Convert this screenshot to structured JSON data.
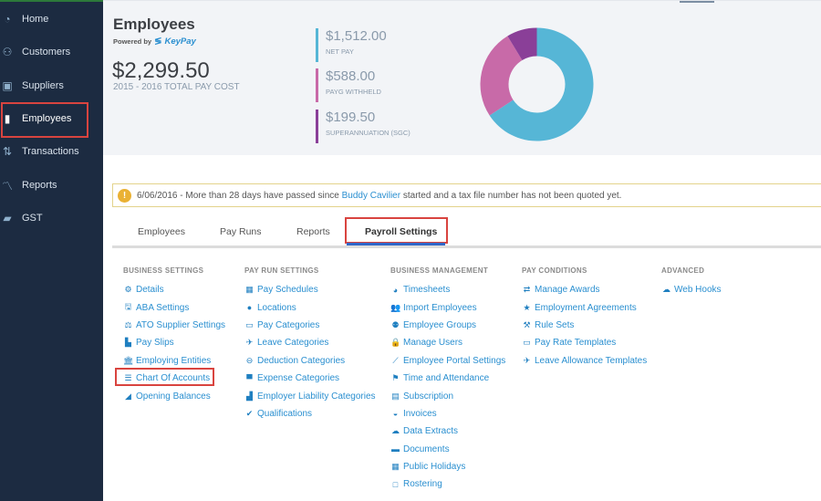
{
  "sidebar": {
    "items": [
      {
        "label": "Home",
        "icon": "dashboard-icon"
      },
      {
        "label": "Customers",
        "icon": "customers-icon"
      },
      {
        "label": "Suppliers",
        "icon": "suppliers-icon"
      },
      {
        "label": "Employees",
        "icon": "employee-badge-icon",
        "active": true
      },
      {
        "label": "Transactions",
        "icon": "transactions-icon"
      },
      {
        "label": "Reports",
        "icon": "chart-line-icon"
      },
      {
        "label": "GST",
        "icon": "gst-icon"
      }
    ]
  },
  "summary": {
    "title": "Employees",
    "powered_by": "Powered by",
    "brand": "KeyPay",
    "total_value": "$2,299.50",
    "total_label": "2015 - 2016 TOTAL PAY COST",
    "stats": [
      {
        "value": "$1,512.00",
        "label": "NET PAY",
        "color": "#56b6d6"
      },
      {
        "value": "$588.00",
        "label": "PAYG WITHHELD",
        "color": "#c86aa8"
      },
      {
        "value": "$199.50",
        "label": "SUPERANNUATION (SGC)",
        "color": "#8a3f98"
      }
    ]
  },
  "chart_data": {
    "type": "pie",
    "title": "",
    "categories": [
      "Net Pay",
      "PAYG Withheld",
      "Superannuation (SGC)"
    ],
    "values": [
      1512.0,
      588.0,
      199.5
    ],
    "colors": [
      "#56b6d6",
      "#c86aa8",
      "#8a3f98"
    ],
    "donut": true
  },
  "alert": {
    "prefix": "6/06/2016 - More than 28 days have passed since ",
    "link": "Buddy Cavilier",
    "suffix": " started and a tax file number has not been quoted yet."
  },
  "tabs": [
    {
      "label": "Employees"
    },
    {
      "label": "Pay Runs"
    },
    {
      "label": "Reports"
    },
    {
      "label": "Payroll Settings",
      "active": true
    }
  ],
  "settings": {
    "business_settings": {
      "heading": "BUSINESS SETTINGS",
      "links": [
        {
          "label": "Details",
          "icon": "gear-icon"
        },
        {
          "label": "ABA Settings",
          "icon": "floppy-disk-icon"
        },
        {
          "label": "ATO Supplier Settings",
          "icon": "scales-icon"
        },
        {
          "label": "Pay Slips",
          "icon": "file-icon"
        },
        {
          "label": "Employing Entities",
          "icon": "bank-icon"
        },
        {
          "label": "Chart Of Accounts",
          "icon": "list-icon"
        },
        {
          "label": "Opening Balances",
          "icon": "leaf-icon"
        }
      ]
    },
    "pay_run_settings": {
      "heading": "PAY RUN SETTINGS",
      "links": [
        {
          "label": "Pay Schedules",
          "icon": "calendar-icon"
        },
        {
          "label": "Locations",
          "icon": "globe-icon"
        },
        {
          "label": "Pay Categories",
          "icon": "money-icon"
        },
        {
          "label": "Leave Categories",
          "icon": "plane-icon"
        },
        {
          "label": "Deduction Categories",
          "icon": "minus-circle-icon"
        },
        {
          "label": "Expense Categories",
          "icon": "expense-icon"
        },
        {
          "label": "Employer Liability Categories",
          "icon": "industry-icon"
        },
        {
          "label": "Qualifications",
          "icon": "check-icon"
        }
      ]
    },
    "business_management": {
      "heading": "BUSINESS MANAGEMENT",
      "links": [
        {
          "label": "Timesheets",
          "icon": "clock-icon"
        },
        {
          "label": "Import Employees",
          "icon": "people-icon"
        },
        {
          "label": "Employee Groups",
          "icon": "group-icon"
        },
        {
          "label": "Manage Users",
          "icon": "lock-icon"
        },
        {
          "label": "Employee Portal Settings",
          "icon": "magic-wand-icon"
        },
        {
          "label": "Time and Attendance",
          "icon": "flag-icon"
        },
        {
          "label": "Subscription",
          "icon": "credit-card-icon"
        },
        {
          "label": "Invoices",
          "icon": "inbox-icon"
        },
        {
          "label": "Data Extracts",
          "icon": "cloud-download-icon"
        },
        {
          "label": "Documents",
          "icon": "folder-icon"
        },
        {
          "label": "Public Holidays",
          "icon": "calendar-icon"
        },
        {
          "label": "Rostering",
          "icon": "calendar-blank-icon"
        }
      ]
    },
    "pay_conditions": {
      "heading": "PAY CONDITIONS",
      "links": [
        {
          "label": "Manage Awards",
          "icon": "exchange-icon"
        },
        {
          "label": "Employment Agreements",
          "icon": "star-icon"
        },
        {
          "label": "Rule Sets",
          "icon": "gavel-icon"
        },
        {
          "label": "Pay Rate Templates",
          "icon": "money-icon"
        },
        {
          "label": "Leave Allowance Templates",
          "icon": "plane-icon"
        }
      ]
    },
    "advanced": {
      "heading": "ADVANCED",
      "links": [
        {
          "label": "Web Hooks",
          "icon": "cloud-icon"
        }
      ]
    }
  }
}
